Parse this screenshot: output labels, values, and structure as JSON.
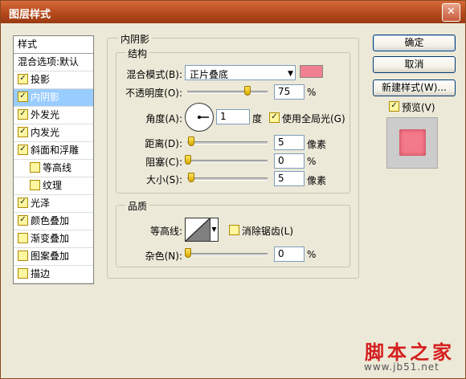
{
  "window": {
    "title": "图层样式",
    "close": "✕"
  },
  "styles_list": {
    "header": "样式",
    "items": [
      {
        "label": "混合选项:默认",
        "checkbox": false,
        "checked": false,
        "selected": false,
        "indent": 0
      },
      {
        "label": "投影",
        "checkbox": true,
        "checked": true,
        "selected": false,
        "indent": 0
      },
      {
        "label": "内阴影",
        "checkbox": true,
        "checked": true,
        "selected": true,
        "indent": 0
      },
      {
        "label": "外发光",
        "checkbox": true,
        "checked": true,
        "selected": false,
        "indent": 0
      },
      {
        "label": "内发光",
        "checkbox": true,
        "checked": true,
        "selected": false,
        "indent": 0
      },
      {
        "label": "斜面和浮雕",
        "checkbox": true,
        "checked": true,
        "selected": false,
        "indent": 0
      },
      {
        "label": "等高线",
        "checkbox": true,
        "checked": false,
        "selected": false,
        "indent": 1
      },
      {
        "label": "纹理",
        "checkbox": true,
        "checked": false,
        "selected": false,
        "indent": 1
      },
      {
        "label": "光泽",
        "checkbox": true,
        "checked": true,
        "selected": false,
        "indent": 0
      },
      {
        "label": "颜色叠加",
        "checkbox": true,
        "checked": true,
        "selected": false,
        "indent": 0
      },
      {
        "label": "渐变叠加",
        "checkbox": true,
        "checked": false,
        "selected": false,
        "indent": 0
      },
      {
        "label": "图案叠加",
        "checkbox": true,
        "checked": false,
        "selected": false,
        "indent": 0
      },
      {
        "label": "描边",
        "checkbox": true,
        "checked": false,
        "selected": false,
        "indent": 0
      }
    ]
  },
  "inner_shadow": {
    "title": "内阴影",
    "structure": {
      "title": "结构",
      "blend_mode_label": "混合模式(B):",
      "blend_mode_value": "正片叠底",
      "shadow_color": "#f08090",
      "opacity_label": "不透明度(O):",
      "opacity_value": "75",
      "opacity_fraction": 0.75,
      "opacity_unit": "%",
      "angle_label": "角度(A):",
      "angle_value": "1",
      "angle_unit": "度",
      "global_light_label": "使用全局光(G)",
      "global_light_checked": true,
      "distance_label": "距离(D):",
      "distance_value": "5",
      "distance_unit": "像素",
      "choke_label": "阻塞(C):",
      "choke_value": "0",
      "choke_unit": "%",
      "size_label": "大小(S):",
      "size_value": "5",
      "size_unit": "像素"
    },
    "quality": {
      "title": "品质",
      "contour_label": "等高线:",
      "antialias_label": "消除锯齿(L)",
      "antialias_checked": false,
      "noise_label": "杂色(N):",
      "noise_value": "0",
      "noise_unit": "%"
    }
  },
  "buttons": {
    "ok": "确定",
    "cancel": "取消",
    "new_style": "新建样式(W)...",
    "preview_label": "预览(V)",
    "preview_checked": true,
    "preview_color": "#f37a8a"
  },
  "watermark": {
    "main": "脚本之家",
    "sub": "www.jb51.net"
  }
}
